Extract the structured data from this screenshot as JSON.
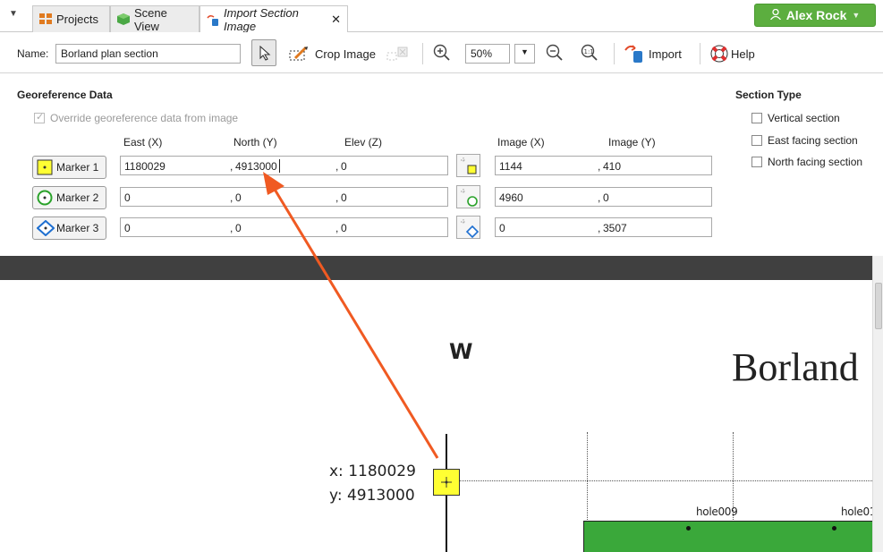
{
  "tabs": [
    {
      "label": "Projects",
      "icon": "grid-icon"
    },
    {
      "label": "Scene View",
      "icon": "cube-icon"
    },
    {
      "label": "Import Section Image",
      "icon": "import-image-icon",
      "close": "✕"
    }
  ],
  "user": {
    "name": "Alex Rock",
    "icon": "user-icon",
    "color": "#5cae3f"
  },
  "toolbar": {
    "name_label": "Name:",
    "name_value": "Borland plan section",
    "crop_label": "Crop Image",
    "zoom_value": "50%",
    "import_label": "Import",
    "help_label": "Help"
  },
  "geo": {
    "heading": "Georeference Data",
    "override_label": "Override georeference data from image",
    "cols": {
      "east": "East (X)",
      "north": "North (Y)",
      "elev": "Elev (Z)",
      "imgx": "Image (X)",
      "imgy": "Image (Y)"
    },
    "sep": ",",
    "markers": [
      {
        "label": "Marker 1",
        "east": "1180029",
        "north": "4913000",
        "elev": "0",
        "imgx": "1144",
        "imgy": "410"
      },
      {
        "label": "Marker 2",
        "east": "0",
        "north": "0",
        "elev": "0",
        "imgx": "4960",
        "imgy": "0"
      },
      {
        "label": "Marker 3",
        "east": "0",
        "north": "0",
        "elev": "0",
        "imgx": "0",
        "imgy": "3507"
      }
    ]
  },
  "section_type": {
    "heading": "Section Type",
    "options": [
      "Vertical section",
      "East facing section",
      "North facing section"
    ]
  },
  "image": {
    "compass": "W",
    "title": "Borland",
    "coord_x": "x: 1180029",
    "coord_y": "y: 4913000",
    "holes": [
      "hole009",
      "hole01"
    ]
  },
  "colors": {
    "accent_arrow": "#f05a22",
    "marker_yellow": "#ffff33",
    "marker_green": "#2aa22a",
    "marker_blue": "#1e6fd0",
    "section_green": "#3aa83a"
  }
}
